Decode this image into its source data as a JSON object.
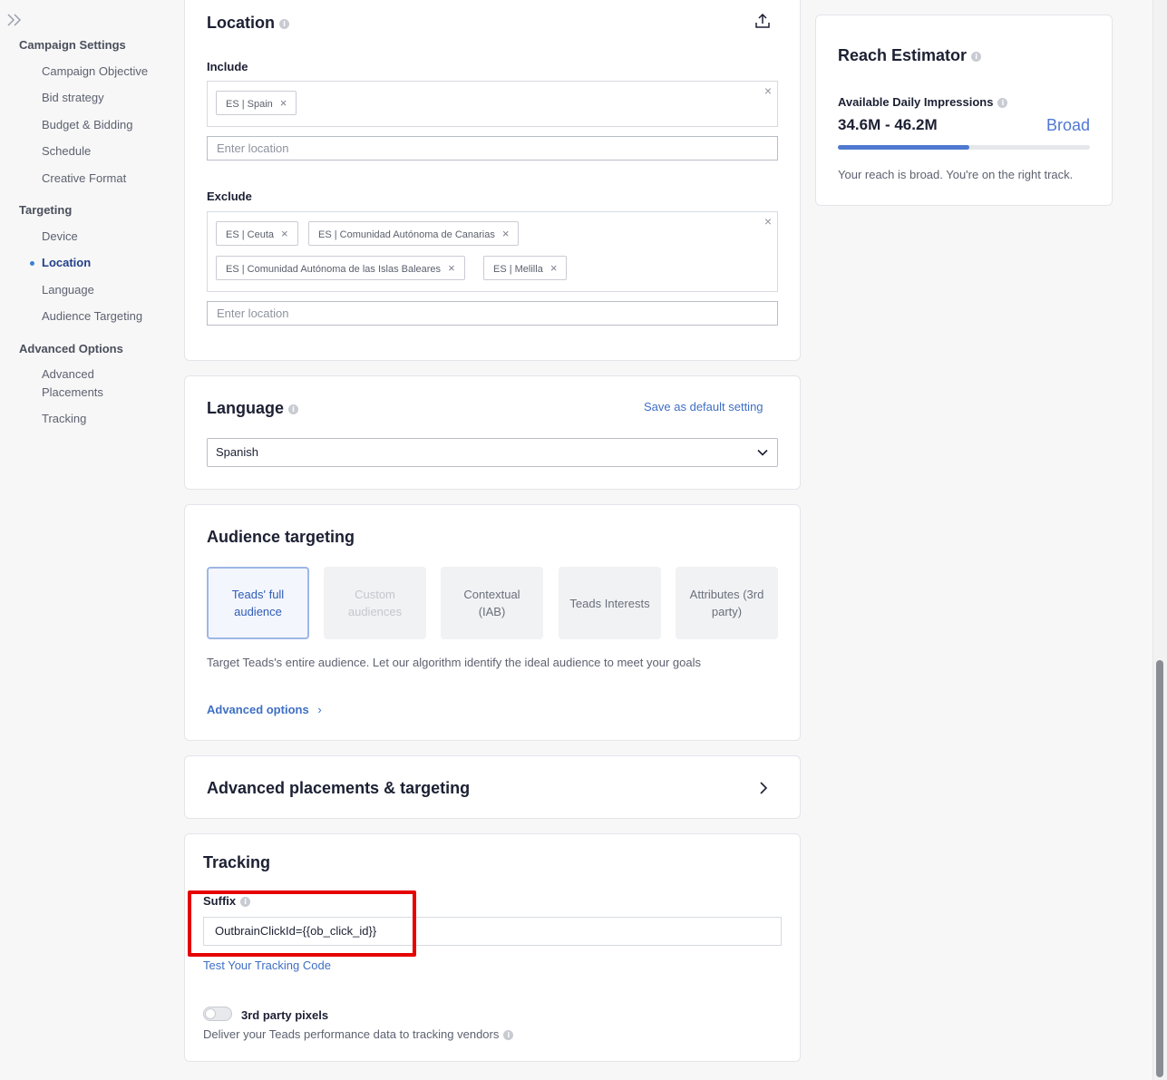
{
  "sidebar": {
    "groups": [
      {
        "label": "Campaign Settings",
        "items": [
          "Campaign Objective",
          "Bid strategy",
          "Budget & Bidding",
          "Schedule",
          "Creative Format"
        ]
      },
      {
        "label": "Targeting",
        "items": [
          "Device",
          "Location",
          "Language",
          "Audience Targeting"
        ]
      },
      {
        "label": "Advanced Options",
        "items": [
          "Advanced Placements",
          "Tracking"
        ]
      }
    ],
    "active_item": "Location"
  },
  "location": {
    "title": "Location",
    "include_label": "Include",
    "include_tags": [
      "ES | Spain"
    ],
    "exclude_label": "Exclude",
    "exclude_tags": [
      "ES | Ceuta",
      "ES | Comunidad Autónoma de Canarias",
      "ES | Comunidad Autónoma de las Islas Baleares",
      "ES | Melilla"
    ],
    "placeholder": "Enter location"
  },
  "language": {
    "title": "Language",
    "save_default": "Save as default setting",
    "selected": "Spanish"
  },
  "audience": {
    "title": "Audience targeting",
    "options": [
      {
        "label": "Teads' full audience",
        "state": "active"
      },
      {
        "label": "Custom audiences",
        "state": "disabled"
      },
      {
        "label": "Contextual (IAB)",
        "state": "normal"
      },
      {
        "label": "Teads Interests",
        "state": "normal"
      },
      {
        "label": "Attributes (3rd party)",
        "state": "normal"
      }
    ],
    "description": "Target Teads's entire audience. Let our algorithm identify the ideal audience to meet your goals",
    "advanced_link": "Advanced options"
  },
  "advanced_placements": {
    "title": "Advanced placements & targeting"
  },
  "tracking": {
    "title": "Tracking",
    "suffix_label": "Suffix",
    "suffix_value": "OutbrainClickId={{ob_click_id}}",
    "test_link": "Test Your Tracking Code",
    "pixels_label": "3rd party pixels",
    "pixels_desc": "Deliver your Teads performance data to tracking vendors",
    "pixels_enabled": false
  },
  "reach": {
    "title": "Reach Estimator",
    "metric_label": "Available Daily Impressions",
    "range": "34.6M - 46.2M",
    "level": "Broad",
    "fill_fraction": 0.52,
    "message": "Your reach is broad. You're on the right track."
  },
  "colors": {
    "accent": "#3f6fc4",
    "highlight": "#e60000"
  }
}
